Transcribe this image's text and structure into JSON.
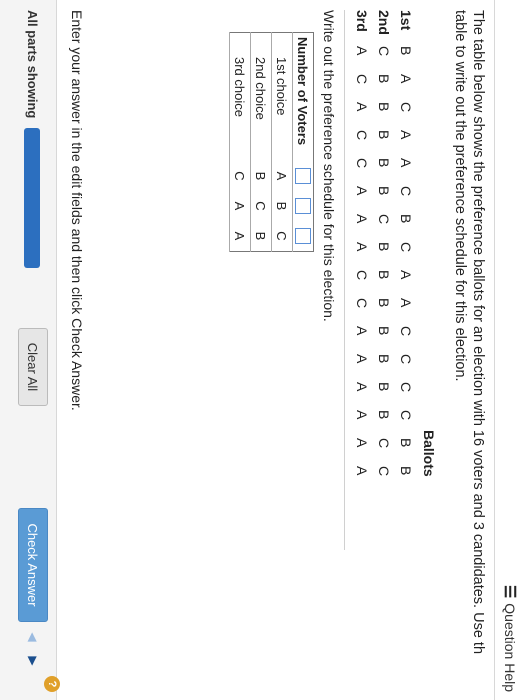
{
  "header": {
    "help_label": "Question Help",
    "help_icon": "list-icon"
  },
  "question": {
    "line1": "The table below shows the preference ballots for an election with 16 voters and 3 candidates. Use th",
    "line2": "table to write out the preference schedule for this election."
  },
  "ballots": {
    "title": "Ballots",
    "rows": [
      {
        "rank": "1st",
        "cells": [
          "B",
          "A",
          "C",
          "A",
          "A",
          "C",
          "B",
          "C",
          "A",
          "A",
          "C",
          "C",
          "C",
          "C",
          "B",
          "B"
        ]
      },
      {
        "rank": "2nd",
        "cells": [
          "C",
          "B",
          "B",
          "B",
          "B",
          "B",
          "C",
          "B",
          "B",
          "B",
          "B",
          "B",
          "B",
          "B",
          "C",
          "C"
        ]
      },
      {
        "rank": "3rd",
        "cells": [
          "A",
          "C",
          "A",
          "C",
          "C",
          "A",
          "A",
          "A",
          "C",
          "C",
          "A",
          "A",
          "A",
          "A",
          "A",
          "A"
        ]
      }
    ]
  },
  "schedule": {
    "instruction": "Write out the preference schedule for this election.",
    "header": "Number of Voters",
    "rows": [
      {
        "label": "1st choice",
        "values": [
          "A",
          "B",
          "C"
        ]
      },
      {
        "label": "2nd choice",
        "values": [
          "B",
          "C",
          "B"
        ]
      },
      {
        "label": "3rd choice",
        "values": [
          "C",
          "A",
          "A"
        ]
      }
    ]
  },
  "footer": {
    "enter_instruction": "Enter your answer in the edit fields and then click Check Answer.",
    "parts_label": "All parts showing",
    "progress": 1.0,
    "clear_label": "Clear All",
    "check_label": "Check Answer",
    "help_badge": "?"
  },
  "colors": {
    "accent": "#2c6fbf",
    "check_button": "#5a9bd5",
    "input_border": "#5a8fd6"
  }
}
